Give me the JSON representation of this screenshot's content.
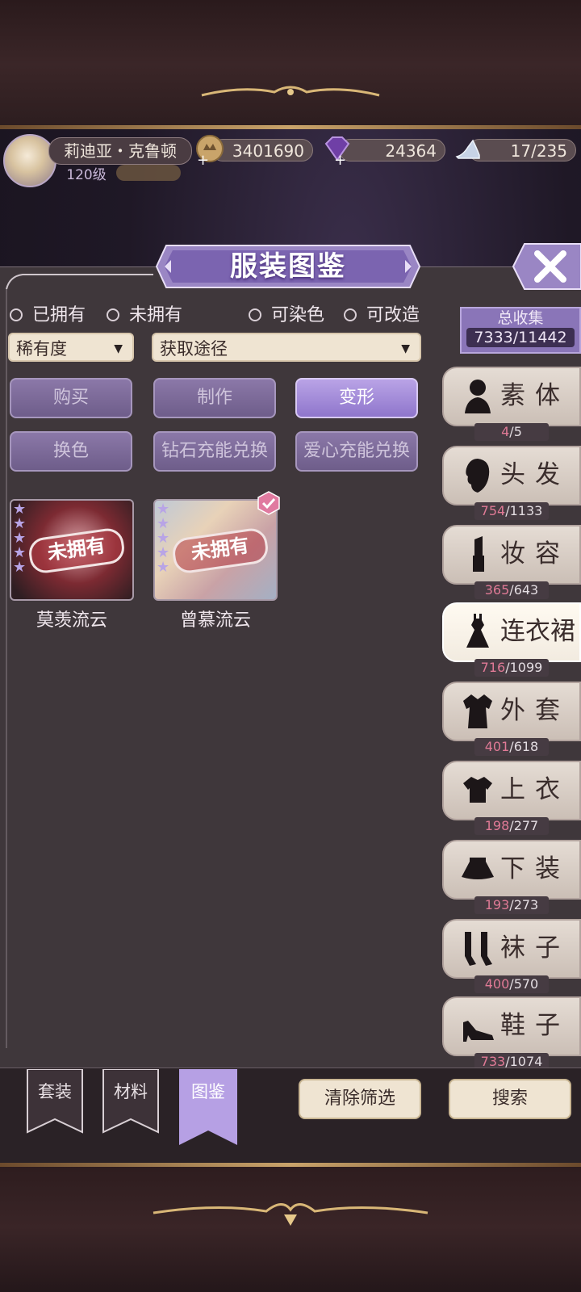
{
  "hud": {
    "player_name": "莉迪亚・克鲁顿",
    "level": "120级",
    "gold": "3401690",
    "diamonds": "24364",
    "stamina": "17/235"
  },
  "panel": {
    "title": "服装图鉴",
    "ownership_filters": [
      "已拥有",
      "未拥有"
    ],
    "attribute_filters": [
      "可染色",
      "可改造"
    ],
    "rarity_select": "稀有度",
    "source_select": "获取途径",
    "source_buttons": [
      {
        "label": "购买",
        "active": false
      },
      {
        "label": "制作",
        "active": false
      },
      {
        "label": "变形",
        "active": true
      },
      {
        "label": "换色",
        "active": false
      },
      {
        "label": "钻石充能兑换",
        "active": false
      },
      {
        "label": "爱心充能兑换",
        "active": false
      }
    ],
    "items": [
      {
        "name": "莫羡流云",
        "status": "未拥有",
        "stars": 5
      },
      {
        "name": "曾慕流云",
        "status": "未拥有",
        "stars": 5,
        "checked": true
      }
    ]
  },
  "collection": {
    "label": "总收集",
    "count": "7333/11442"
  },
  "categories": [
    {
      "label": "素体",
      "have": "4",
      "total": "/5",
      "icon": "body-icon",
      "selected": false
    },
    {
      "label": "头发",
      "have": "754",
      "total": "/1133",
      "icon": "hair-icon",
      "selected": false
    },
    {
      "label": "妆容",
      "have": "365",
      "total": "/643",
      "icon": "lipstick-icon",
      "selected": false
    },
    {
      "label": "连衣裙",
      "have": "716",
      "total": "/1099",
      "icon": "dress-icon",
      "selected": true
    },
    {
      "label": "外套",
      "have": "401",
      "total": "/618",
      "icon": "coat-icon",
      "selected": false
    },
    {
      "label": "上衣",
      "have": "198",
      "total": "/277",
      "icon": "top-icon",
      "selected": false
    },
    {
      "label": "下装",
      "have": "193",
      "total": "/273",
      "icon": "skirt-icon",
      "selected": false
    },
    {
      "label": "袜子",
      "have": "400",
      "total": "/570",
      "icon": "socks-icon",
      "selected": false
    },
    {
      "label": "鞋子",
      "have": "733",
      "total": "/1074",
      "icon": "heel-icon",
      "selected": false
    }
  ],
  "bottom": {
    "tabs": [
      "套装",
      "材料",
      "图鉴"
    ],
    "active_tab": "图鉴",
    "clear_filter": "清除筛选",
    "search": "搜索"
  },
  "colors": {
    "accent_purple": "#8f76cc",
    "panel_bg": "#3f373b",
    "owned_count": "#e07a96"
  }
}
